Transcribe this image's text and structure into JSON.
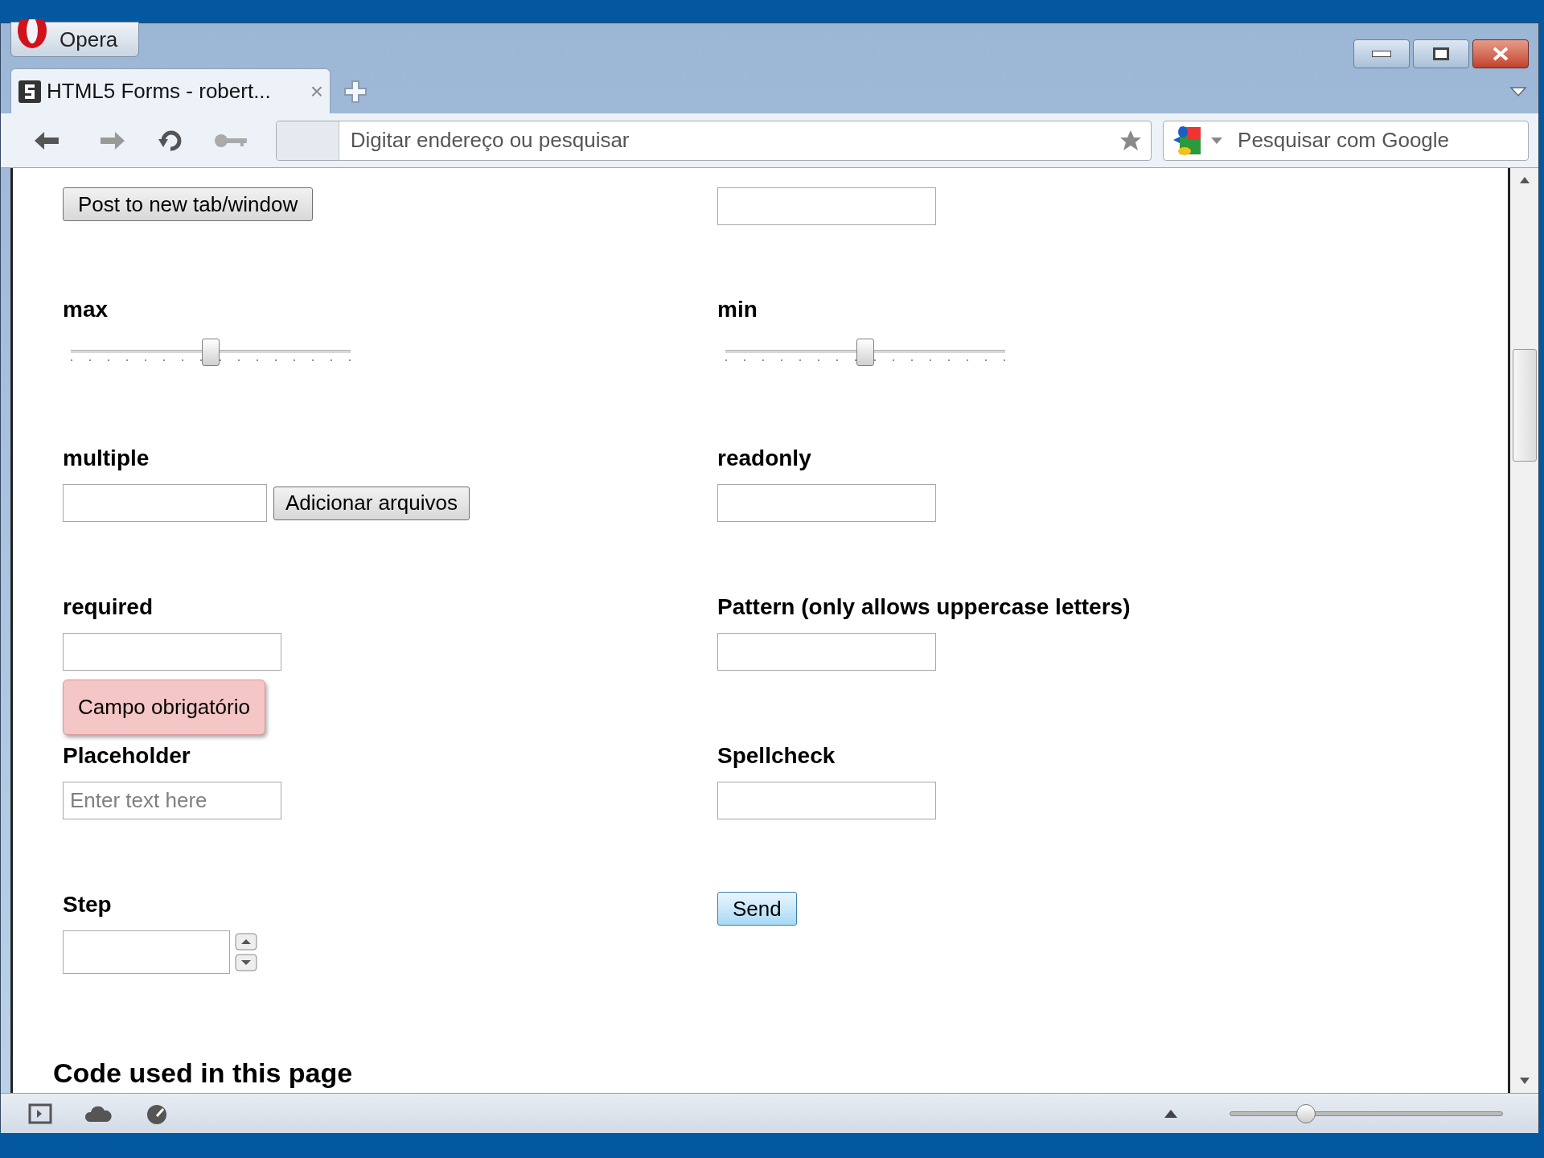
{
  "browser": {
    "app_button": "Opera",
    "tabs": [
      {
        "title": "HTML5 Forms - robert...",
        "close": "×",
        "selected": true
      }
    ],
    "address": {
      "placeholder": "Digitar endereço ou pesquisar"
    },
    "search": {
      "placeholder": "Pesquisar com Google"
    }
  },
  "form": {
    "rows": [
      [
        {
          "kind": "button",
          "label": "Post to new tab/window"
        },
        {
          "kind": "text"
        }
      ],
      [
        {
          "kind": "range",
          "label": "max",
          "level": 0.5
        },
        {
          "kind": "range",
          "label": "min",
          "level": 0.5
        }
      ],
      [
        {
          "kind": "file",
          "label": "multiple",
          "button": "Adicionar arquivos"
        },
        {
          "kind": "text",
          "label": "readonly"
        }
      ],
      [
        {
          "kind": "text",
          "label": "required",
          "tooltip": "Campo obrigatório"
        },
        {
          "kind": "text",
          "label": "Pattern (only allows uppercase letters)"
        }
      ],
      [
        {
          "kind": "text",
          "label": "Placeholder",
          "placeholder": "Enter text here"
        },
        {
          "kind": "text",
          "label": "Spellcheck"
        }
      ],
      [
        {
          "kind": "number",
          "label": "Step"
        },
        {
          "kind": "submit",
          "button": "Send"
        }
      ]
    ],
    "heading": "Code used in this page"
  },
  "status_bar": {
    "zoom": {
      "level": 0.28
    }
  }
}
